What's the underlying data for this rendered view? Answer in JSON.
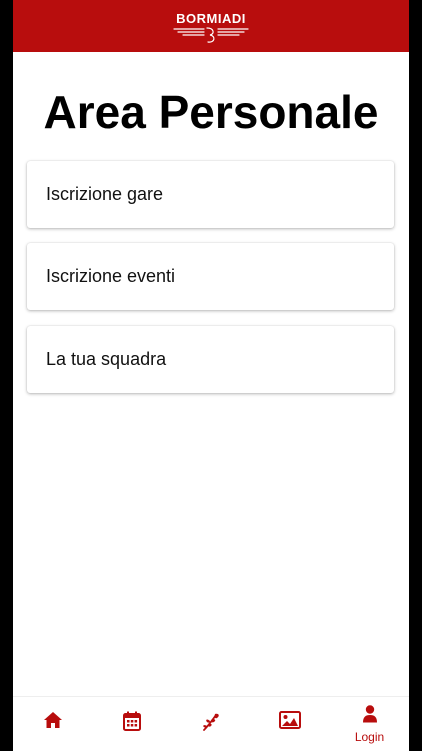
{
  "header": {
    "logo_text": "BORMIADI",
    "brand_color": "#b80d0d"
  },
  "main": {
    "title": "Area Personale",
    "items": [
      {
        "label": "Iscrizione gare"
      },
      {
        "label": "Iscrizione eventi"
      },
      {
        "label": "La tua squadra"
      }
    ]
  },
  "tabbar": {
    "tabs": [
      {
        "icon": "home-icon",
        "label": ""
      },
      {
        "icon": "calendar-icon",
        "label": ""
      },
      {
        "icon": "plant-icon",
        "label": ""
      },
      {
        "icon": "image-icon",
        "label": ""
      },
      {
        "icon": "user-icon",
        "label": "Login"
      }
    ]
  }
}
